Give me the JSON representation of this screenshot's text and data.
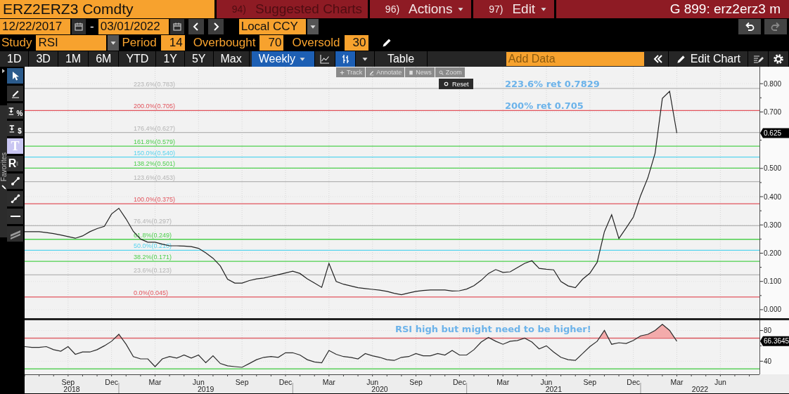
{
  "header": {
    "security": "ERZ2ERZ3 Comdty",
    "menus": [
      {
        "number": "94)",
        "label": "Suggested Charts",
        "disabled": true,
        "dropdown": false
      },
      {
        "number": "96)",
        "label": "Actions",
        "disabled": false,
        "dropdown": true
      },
      {
        "number": "97)",
        "label": "Edit",
        "disabled": false,
        "dropdown": true
      }
    ],
    "page_id": "G 899: erz2erz3 m"
  },
  "date_bar": {
    "start_date": "12/22/2017",
    "separator": "-",
    "end_date": "03/01/2022",
    "currency": "Local CCY"
  },
  "study_bar": {
    "fields": [
      {
        "label": "Study",
        "value": "RSI",
        "kind": "dropdown"
      },
      {
        "label": "Period",
        "value": "14",
        "kind": "number"
      },
      {
        "label": "Overbought",
        "value": "70",
        "kind": "number"
      },
      {
        "label": "Oversold",
        "value": "30",
        "kind": "number"
      }
    ]
  },
  "toolbar": {
    "ranges": [
      {
        "label": "1D",
        "selected": false
      },
      {
        "label": "3D",
        "selected": false
      },
      {
        "label": "1M",
        "selected": false
      },
      {
        "label": "6M",
        "selected": false
      },
      {
        "label": "YTD",
        "selected": false
      },
      {
        "label": "1Y",
        "selected": false
      },
      {
        "label": "5Y",
        "selected": false
      },
      {
        "label": "Max",
        "selected": false
      }
    ],
    "frequency": {
      "label": "Weekly",
      "selected": true
    },
    "chart_types": [
      {
        "kind": "line",
        "selected": false
      },
      {
        "kind": "bar",
        "selected": true
      }
    ],
    "table": "Table",
    "add_data": {
      "placeholder": "Add Data"
    },
    "edit_chart": "Edit Chart"
  },
  "drawing_tools": {
    "tab": "Favorites",
    "tools": [
      {
        "kind": "select",
        "selected": true
      },
      {
        "kind": "pen",
        "selected": false
      },
      {
        "kind": "text-down",
        "label": "%",
        "selected": false
      },
      {
        "kind": "text-down",
        "label": "$",
        "selected": false
      },
      {
        "kind": "text",
        "label": "T",
        "selected": false
      },
      {
        "kind": "legend",
        "label": "R",
        "selected": false
      },
      {
        "kind": "line",
        "selected": false
      },
      {
        "kind": "multi-line",
        "selected": false
      },
      {
        "kind": "hline",
        "selected": false
      },
      {
        "kind": "channel",
        "selected": false
      }
    ]
  },
  "chart_controls": {
    "tools": [
      {
        "kind": "track",
        "label": "Track"
      },
      {
        "kind": "annotate",
        "label": "Annotate"
      },
      {
        "kind": "news",
        "label": "News"
      },
      {
        "kind": "zoom",
        "label": "Zoom"
      }
    ],
    "reset": "Reset"
  },
  "price_panel": {
    "last_value": "0.625",
    "chart_data": {
      "type": "line",
      "grid": true,
      "categories": [
        null,
        null,
        null,
        null,
        null,
        null,
        null,
        null,
        null,
        null,
        null,
        null,
        null,
        null,
        null,
        null,
        null,
        null,
        null,
        null,
        null,
        null,
        null,
        null,
        null,
        null,
        null,
        null,
        null,
        null,
        null,
        null,
        null,
        null,
        null,
        null,
        null,
        null,
        null,
        null,
        null,
        null,
        null,
        null,
        null,
        null,
        null,
        null,
        null,
        null,
        null,
        null,
        null,
        null,
        null,
        null,
        null,
        null,
        null,
        null,
        null,
        null,
        null,
        null,
        null,
        null,
        null,
        null,
        null,
        null,
        null,
        null,
        null,
        null,
        null,
        null,
        null,
        null,
        null,
        null,
        null,
        null,
        null,
        null,
        null,
        null,
        null,
        null,
        null,
        null,
        null
      ],
      "series": [
        {
          "color": "#222222",
          "values": [
            0.276,
            0.276,
            0.276,
            0.273,
            0.269,
            0.264,
            0.259,
            0.253,
            0.261,
            0.276,
            0.287,
            0.295,
            0.339,
            0.359,
            0.321,
            0.277,
            0.25,
            0.239,
            0.239,
            0.232,
            0.226,
            0.226,
            0.225,
            0.223,
            0.217,
            0.201,
            0.182,
            0.155,
            0.108,
            0.094,
            0.094,
            0.103,
            0.109,
            0.112,
            0.118,
            0.124,
            0.13,
            0.136,
            0.128,
            0.109,
            0.094,
            0.079,
            0.164,
            0.1,
            0.09,
            0.084,
            0.078,
            0.075,
            0.072,
            0.069,
            0.065,
            0.058,
            0.053,
            0.059,
            0.065,
            0.068,
            0.07,
            0.07,
            0.07,
            0.066,
            0.067,
            0.073,
            0.085,
            0.104,
            0.128,
            0.142,
            0.132,
            0.134,
            0.149,
            0.164,
            0.173,
            0.146,
            0.143,
            0.141,
            0.1,
            0.084,
            0.078,
            0.108,
            0.129,
            0.168,
            0.276,
            0.336,
            0.252,
            0.289,
            0.328,
            0.404,
            0.467,
            0.554,
            0.748,
            0.773,
            0.625
          ]
        }
      ],
      "ylim": [
        -0.03,
        0.86
      ],
      "yticks": [
        {
          "value": 0,
          "label": "0.000"
        },
        {
          "value": 0.1,
          "label": "0.100"
        },
        {
          "value": 0.2,
          "label": "0.200"
        },
        {
          "value": 0.3,
          "label": "0.300"
        },
        {
          "value": 0.4,
          "label": "0.400"
        },
        {
          "value": 0.5,
          "label": "0.500"
        },
        {
          "value": 0.7,
          "label": "0.700"
        },
        {
          "value": 0.8,
          "label": "0.800"
        }
      ],
      "ref_lines": [
        {
          "axis": "y",
          "value": 0.783,
          "label": "223.6%(0.783)",
          "color": "#b4b4b4"
        },
        {
          "axis": "y",
          "value": 0.705,
          "label": "200.0%(0.705)",
          "color": "#e2535c"
        },
        {
          "axis": "y",
          "value": 0.627,
          "label": "176.4%(0.627)",
          "color": "#b4b4b4"
        },
        {
          "axis": "y",
          "value": 0.579,
          "label": "161.8%(0.579)",
          "color": "#4ccf4c"
        },
        {
          "axis": "y",
          "value": 0.54,
          "label": "150.0%(0.540)",
          "color": "#56d4ee"
        },
        {
          "axis": "y",
          "value": 0.501,
          "label": "138.2%(0.501)",
          "color": "#4ccf4c"
        },
        {
          "axis": "y",
          "value": 0.453,
          "label": "123.6%(0.453)",
          "color": "#b4b4b4"
        },
        {
          "axis": "y",
          "value": 0.375,
          "label": "100.0%(0.375)",
          "color": "#e2535c"
        },
        {
          "axis": "y",
          "value": 0.297,
          "label": "76.4%(0.297)",
          "color": "#b4b4b4"
        },
        {
          "axis": "y",
          "value": 0.249,
          "label": "61.8%(0.249)",
          "color": "#4ccf4c"
        },
        {
          "axis": "y",
          "value": 0.21,
          "label": "50.0%(0.210)",
          "color": "#56d4ee"
        },
        {
          "axis": "y",
          "value": 0.171,
          "label": "38.2%(0.171)",
          "color": "#4ccf4c"
        },
        {
          "axis": "y",
          "value": 0.123,
          "label": "23.6%(0.123)",
          "color": "#b4b4b4"
        },
        {
          "axis": "y",
          "value": 0.045,
          "label": "0.0%(0.045)",
          "color": "#e2535c"
        }
      ],
      "annotations": [
        "223.6% ret 0.7829",
        "200% ret 0.705"
      ]
    }
  },
  "rsi_panel": {
    "last_value": "66.3645",
    "shade_overbought": true,
    "year_labels": [
      "2018",
      "2019",
      "2020",
      "2021",
      "2022"
    ],
    "chart_data": {
      "type": "line",
      "grid": true,
      "categories": [
        null,
        null,
        null,
        null,
        null,
        null,
        "Sep",
        null,
        null,
        null,
        null,
        null,
        "Dec",
        null,
        null,
        null,
        null,
        null,
        "Mar",
        null,
        null,
        null,
        null,
        null,
        "Jun",
        null,
        null,
        null,
        null,
        null,
        "Sep",
        null,
        null,
        null,
        null,
        null,
        "Dec",
        null,
        null,
        null,
        null,
        null,
        "Mar",
        null,
        null,
        null,
        null,
        null,
        "Jun",
        null,
        null,
        null,
        null,
        null,
        "Sep",
        null,
        null,
        null,
        null,
        null,
        "Dec",
        null,
        null,
        null,
        null,
        null,
        "Mar",
        null,
        null,
        null,
        null,
        null,
        "Jun",
        null,
        null,
        null,
        null,
        null,
        "Sep",
        null,
        null,
        null,
        null,
        null,
        "Dec",
        null,
        null,
        null,
        null,
        null,
        "Mar",
        null,
        null,
        null,
        null,
        null,
        "Jun",
        null,
        null,
        null
      ],
      "series": [
        {
          "color": "#2a2a2a",
          "values": [
            59,
            58,
            58,
            59,
            55,
            53,
            59,
            49,
            52,
            52,
            55,
            60,
            66,
            75,
            62,
            46,
            43,
            43,
            33,
            43,
            46,
            44,
            48,
            44,
            48,
            38,
            47,
            37,
            34,
            33,
            32,
            37,
            42,
            45,
            46,
            45,
            51,
            51,
            48,
            42,
            39,
            38,
            54,
            49,
            46,
            45,
            43,
            50,
            47,
            45,
            42,
            41,
            45,
            46,
            50,
            47,
            47,
            50,
            48,
            54,
            48,
            48,
            55,
            65,
            71,
            66,
            62,
            66,
            67,
            70,
            65,
            56,
            60,
            52,
            45,
            42,
            41,
            50,
            59,
            66,
            80,
            62,
            64,
            63,
            67,
            73,
            75,
            80,
            88,
            80,
            66,
            null,
            null,
            null,
            null,
            null,
            null,
            null,
            null,
            null
          ]
        }
      ],
      "ylim": [
        22.9,
        93.3
      ],
      "yticks": [
        {
          "value": 40,
          "label": "40"
        },
        {
          "value": 80,
          "label": "80"
        }
      ],
      "ref_lines": [
        {
          "axis": "y",
          "value": 70,
          "color": "#d9535b"
        },
        {
          "axis": "y",
          "value": 30,
          "color": "#5ad05a"
        }
      ],
      "annotations": [
        "RSI high but might need to be higher!"
      ]
    }
  }
}
